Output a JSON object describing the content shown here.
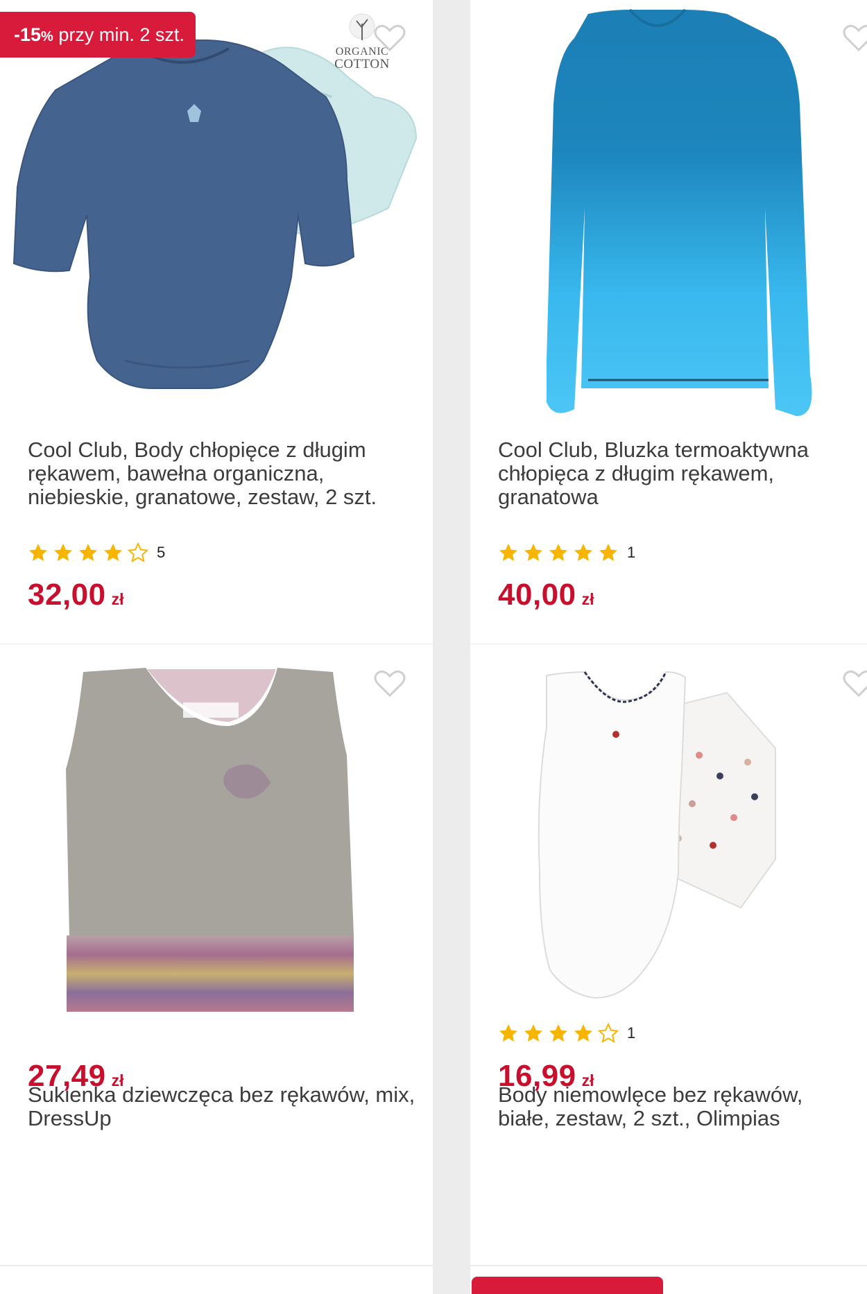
{
  "promo": {
    "discount_value": "-15",
    "discount_pct": "%",
    "condition": "przy min. 2 szt."
  },
  "organic_badge": {
    "line1": "ORGANIC",
    "line2": "COTTON"
  },
  "colors": {
    "price": "#c8102e",
    "badge": "#d81b3a",
    "star": "#f7b500"
  },
  "products": [
    {
      "title": "Cool Club, Body chłopięce z długim rękawem, bawełna organiczna, niebieskie, granatowe, zestaw, 2 szt.",
      "rating": 4,
      "rating_count": "5",
      "price": "32,00",
      "currency": "zł"
    },
    {
      "title": "Cool Club, Bluzka termoaktywna chłopięca z długim rękawem, granatowa",
      "rating": 5,
      "rating_count": "1",
      "price": "40,00",
      "currency": "zł"
    },
    {
      "title": "Sukienka dziewczęca bez rękawów, mix, DressUp",
      "price": "27,49",
      "currency": "zł"
    },
    {
      "title": "Body niemowlęce bez rękawów, białe, zestaw, 2 szt., Olimpias",
      "rating": 4,
      "rating_count": "1",
      "price": "16,99",
      "currency": "zł"
    }
  ],
  "icons": {
    "favorite": "heart-outline-icon",
    "star_full": "star-filled-icon",
    "star_empty": "star-outline-icon"
  }
}
